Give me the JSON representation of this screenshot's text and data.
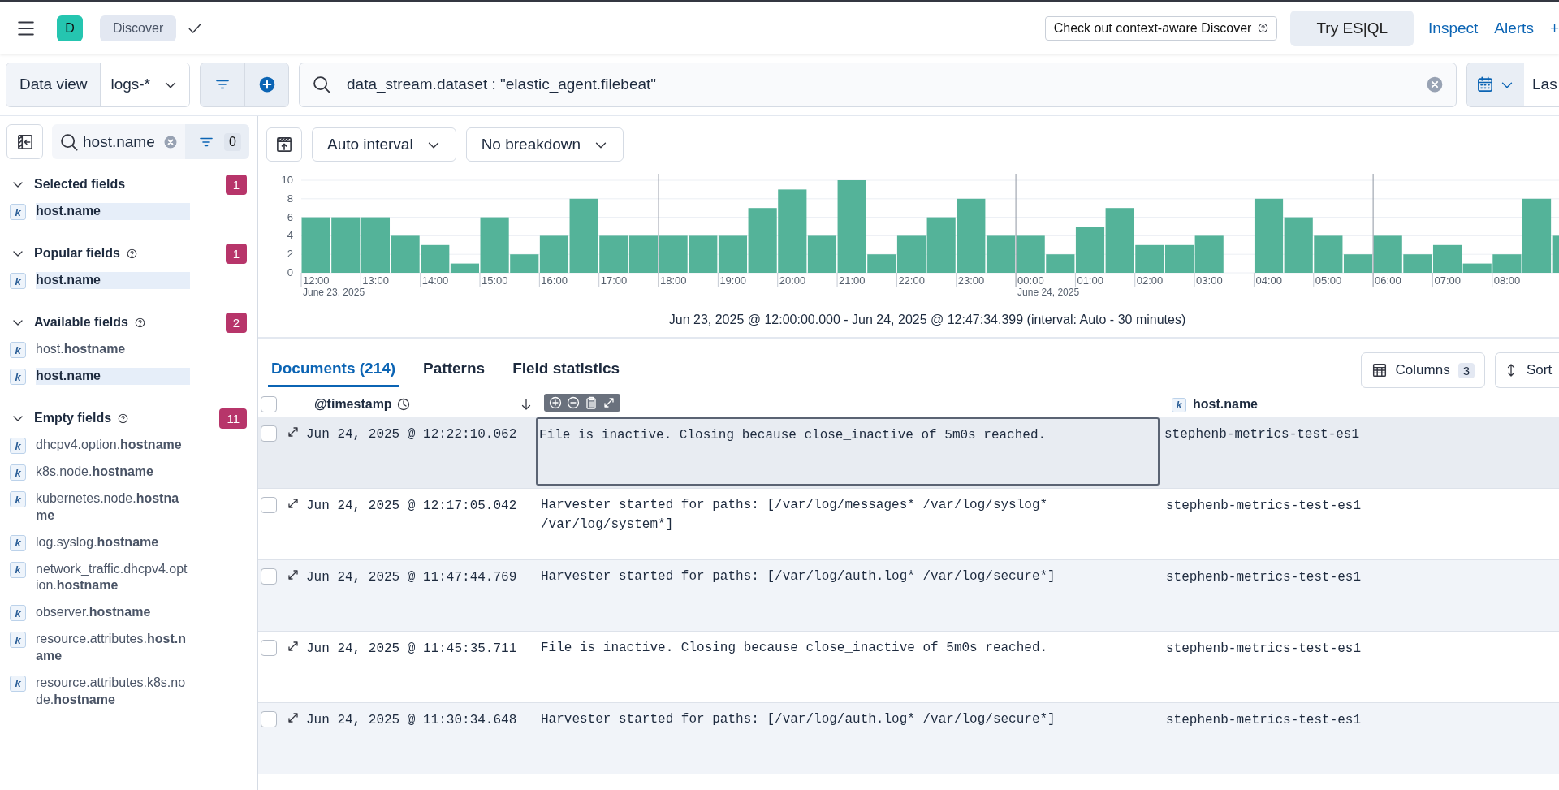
{
  "header": {
    "avatar": "D",
    "breadcrumb": "Discover",
    "callout": "Check out context-aware Discover",
    "esql_button": "Try ES|QL",
    "links": [
      "Inspect",
      "Alerts",
      "+"
    ]
  },
  "query_bar": {
    "data_view_label": "Data view",
    "data_view": "logs-*",
    "query": "data_stream.dataset : \"elastic_agent.filebeat\"",
    "date_label": "Las"
  },
  "sidebar": {
    "search": {
      "value": "host.name"
    },
    "filter_count": "0",
    "groups": [
      {
        "title": "Selected fields",
        "help": false,
        "count": "1",
        "expanded": true,
        "fields": [
          {
            "token": "k",
            "name": "host.name",
            "full_match": true
          }
        ]
      },
      {
        "title": "Popular fields",
        "help": true,
        "count": "1",
        "expanded": true,
        "fields": [
          {
            "token": "k",
            "name": "host.name",
            "full_match": true
          }
        ]
      },
      {
        "title": "Available fields",
        "help": true,
        "count": "2",
        "expanded": true,
        "fields": [
          {
            "token": "k",
            "name": "host.**hostname**",
            "full_match": false
          },
          {
            "token": "k",
            "name": "host.name",
            "full_match": true
          }
        ]
      },
      {
        "title": "Empty fields",
        "help": true,
        "count": "11",
        "expanded": true,
        "fields": [
          {
            "token": "k",
            "name": "dhcpv4.option.**hostname**",
            "full_match": false
          },
          {
            "token": "k",
            "name": "k8s.node.**hostname**",
            "full_match": false
          },
          {
            "token": "k",
            "name": "kubernetes.node.**hostname**",
            "full_match": false
          },
          {
            "token": "k",
            "name": "log.syslog.**hostname**",
            "full_match": false
          },
          {
            "token": "k",
            "name": "network_traffic.dhcpv4.option.**hostname**",
            "full_match": false
          },
          {
            "token": "k",
            "name": "observer.**hostname**",
            "full_match": false
          },
          {
            "token": "k",
            "name": "resource.attributes.**host.name**",
            "full_match": false
          },
          {
            "token": "k",
            "name": "resource.attributes.k8s.node.**hostname**",
            "full_match": false
          }
        ]
      }
    ]
  },
  "histogram": {
    "interval": "Auto interval",
    "breakdown": "No breakdown",
    "chart_data": {
      "type": "bar",
      "categories": [
        "12:00",
        null,
        "13:00",
        null,
        "14:00",
        null,
        "15:00",
        null,
        "16:00",
        null,
        "17:00",
        null,
        "18:00",
        null,
        "19:00",
        null,
        "20:00",
        null,
        "21:00",
        null,
        "22:00",
        null,
        "23:00",
        null,
        "00:00",
        null,
        "01:00",
        null,
        "02:00",
        null,
        "03:00",
        null,
        "04:00",
        null,
        "05:00",
        null,
        "06:00",
        null,
        "07:00",
        null,
        "08:00",
        null,
        null
      ],
      "series": [
        {
          "color": "#54b399",
          "values": [
            6,
            6,
            6,
            4,
            3,
            1,
            6,
            2,
            4,
            8,
            4,
            4,
            4,
            4,
            4,
            7,
            9,
            4,
            10,
            2,
            4,
            6,
            8,
            4,
            4,
            2,
            5,
            7,
            3,
            3,
            4,
            null,
            8,
            6,
            4,
            2,
            4,
            2,
            3,
            1,
            2,
            8,
            4
          ]
        }
      ],
      "ylim": [
        0,
        10
      ],
      "yticks": [
        0,
        2,
        4,
        6,
        8,
        10
      ],
      "grid": true
    },
    "date_labels": [
      "June 23, 2025",
      "June 24, 2025"
    ],
    "caption": "Jun 23, 2025 @ 12:00:00.000 - Jun 24, 2025 @ 12:47:34.399 (interval: Auto - 30 minutes)"
  },
  "tabs": [
    {
      "label": "Documents (214)",
      "selected": true
    },
    {
      "label": "Patterns",
      "selected": false
    },
    {
      "label": "Field statistics",
      "selected": false
    }
  ],
  "columns_button": {
    "label": "Columns",
    "count": "3"
  },
  "sort_button": "Sort",
  "table": {
    "all_checked": false,
    "columns": [
      {
        "label": "@timestamp",
        "kind": "time"
      },
      {
        "kind": "summary"
      },
      {
        "label": "host.name",
        "kind": "keyword",
        "token": "k"
      }
    ],
    "rows": [
      {
        "checked": false,
        "timestamp": "Jun 24, 2025 @ 12:22:10.062",
        "message": "File is inactive. Closing because close_inactive of 5m0s reached.",
        "host": "stephenb-metrics-test-es1",
        "focused": true
      },
      {
        "checked": false,
        "timestamp": "Jun 24, 2025 @ 12:17:05.042",
        "message": "Harvester started for paths: [/var/log/messages* /var/log/syslog* /var/log/system*]",
        "host": "stephenb-metrics-test-es1",
        "focused": false
      },
      {
        "checked": false,
        "timestamp": "Jun 24, 2025 @ 11:47:44.769",
        "message": "Harvester started for paths: [/var/log/auth.log* /var/log/secure*]",
        "host": "stephenb-metrics-test-es1",
        "focused": false
      },
      {
        "checked": false,
        "timestamp": "Jun 24, 2025 @ 11:45:35.711",
        "message": "File is inactive. Closing because close_inactive of 5m0s reached.",
        "host": "stephenb-metrics-test-es1",
        "focused": false
      },
      {
        "checked": false,
        "timestamp": "Jun 24, 2025 @ 11:30:34.648",
        "message": "Harvester started for paths: [/var/log/auth.log* /var/log/secure*]",
        "host": "stephenb-metrics-test-es1",
        "focused": false
      }
    ]
  }
}
